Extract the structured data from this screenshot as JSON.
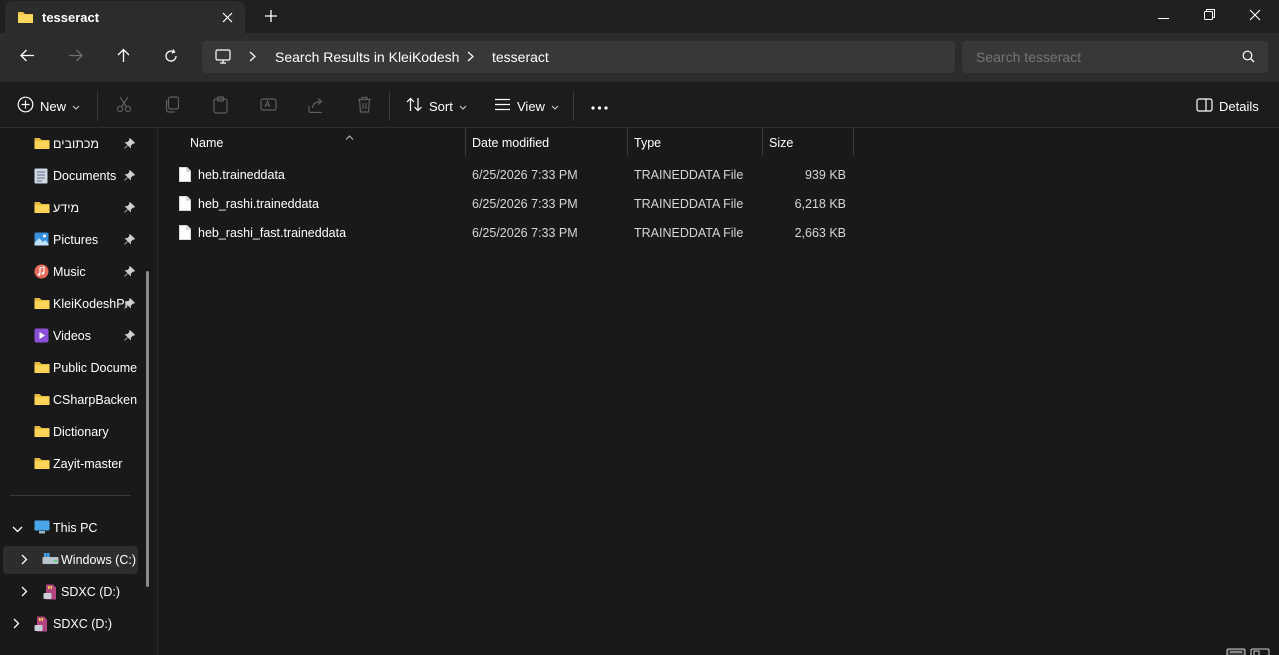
{
  "window": {
    "tab_title": "tesseract",
    "new_tab": "+",
    "controls": [
      "minimize-icon",
      "restore-icon",
      "close-icon"
    ]
  },
  "address": {
    "breadcrumb": [
      "Search Results in KleiKodesh",
      "tesseract"
    ],
    "search_placeholder": "Search tesseract"
  },
  "toolbar": {
    "new_label": "New",
    "sort_label": "Sort",
    "view_label": "View",
    "details_label": "Details",
    "icons": [
      "cut-icon",
      "copy-icon",
      "paste-icon",
      "rename-icon",
      "share-icon",
      "delete-icon",
      "more-icon"
    ]
  },
  "sidebar": {
    "items": [
      {
        "label": "מכתובים",
        "icon": "folder-icon",
        "pinned": true
      },
      {
        "label": "Documents",
        "icon": "documents-icon",
        "pinned": true
      },
      {
        "label": "מידע",
        "icon": "folder-icon",
        "pinned": true
      },
      {
        "label": "Pictures",
        "icon": "pictures-icon",
        "pinned": true
      },
      {
        "label": "Music",
        "icon": "music-icon",
        "pinned": true
      },
      {
        "label": "KleiKodeshPr",
        "icon": "folder-icon",
        "pinned": true
      },
      {
        "label": "Videos",
        "icon": "videos-icon",
        "pinned": true
      },
      {
        "label": "Public Documen",
        "icon": "folder-icon",
        "pinned": false
      },
      {
        "label": "CSharpBackend",
        "icon": "folder-icon",
        "pinned": false
      },
      {
        "label": "Dictionary",
        "icon": "folder-icon",
        "pinned": false
      },
      {
        "label": "Zayit-master",
        "icon": "folder-icon",
        "pinned": false
      }
    ],
    "tree": [
      {
        "label": "This PC",
        "icon": "this-pc-icon",
        "expanded": true
      },
      {
        "label": "Windows (C:)",
        "icon": "windows-drive-icon",
        "expanded": false,
        "selected": true
      },
      {
        "label": "SDXC (D:)",
        "icon": "sd-card-icon",
        "expanded": false
      },
      {
        "label": "SDXC (D:)",
        "icon": "sd-card-icon",
        "expanded": false
      }
    ]
  },
  "columns": {
    "name": "Name",
    "date": "Date modified",
    "type": "Type",
    "size": "Size"
  },
  "files": [
    {
      "name": "heb.traineddata",
      "date": "6/25/2026 7:33 PM",
      "type": "TRAINEDDATA File",
      "size": "939 KB"
    },
    {
      "name": "heb_rashi.traineddata",
      "date": "6/25/2026 7:33 PM",
      "type": "TRAINEDDATA File",
      "size": "6,218 KB"
    },
    {
      "name": "heb_rashi_fast.traineddata",
      "date": "6/25/2026 7:33 PM",
      "type": "TRAINEDDATA File",
      "size": "2,663 KB"
    }
  ],
  "colors": {
    "folder": "#f4c84a",
    "accent": "#4cc2ff",
    "background": "#191919"
  }
}
